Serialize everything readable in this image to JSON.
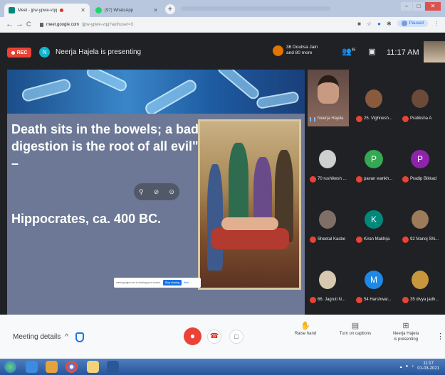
{
  "browser": {
    "tabs": [
      {
        "title": "Meet - jpw-ypwe-vqq",
        "active": true,
        "favicon_color": "#00897b"
      },
      {
        "title": "(97) WhatsApp",
        "active": false,
        "favicon_color": "#25d366"
      }
    ],
    "new_tab_label": "+",
    "window_controls": {
      "minimize": "–",
      "maximize": "□",
      "close": "✕"
    },
    "nav": {
      "back": "←",
      "forward": "→",
      "reload": "C"
    },
    "url_host": "meet.google.com",
    "url_path": "/jpw-ypwe-vqq?authuser=3",
    "profile_status": "Paused"
  },
  "meet_top": {
    "rec_label": "REC",
    "presenter_initial": "N",
    "presenter_text": "Neerja Hajela is presenting",
    "joiners_line1": "36 Doulisa Jain",
    "joiners_line2": "and 80 more",
    "participant_count": "85",
    "time": "11:17 AM"
  },
  "slide": {
    "quote": "Death sits in the bowels; a bad digestion is the root of all evil\" –",
    "author": "Hippocrates, ca. 400 BC.",
    "sharing_text": "meet.google.com is sharing your screen.",
    "stop_sharing": "Stop sharing",
    "hide": "Hide"
  },
  "participants": [
    {
      "name": "Neerja Hajela",
      "speaker": true
    },
    {
      "name": "25. Vighnesh...",
      "photo_color": "#8a5a3c"
    },
    {
      "name": "Pratiksha A",
      "photo_color": "#6b4a3a"
    },
    {
      "name": "70 rushikesh ...",
      "photo_color": "#cfcfcf"
    },
    {
      "name": "pavan wankh...",
      "initial": "P",
      "color": "#34a853"
    },
    {
      "name": "Pradip Bikkad",
      "initial": "P",
      "color": "#8e24aa"
    },
    {
      "name": "Sheetal Kasbe",
      "photo_color": "#7f6f66"
    },
    {
      "name": "Kiran Makhija",
      "initial": "K",
      "color": "#00897b"
    },
    {
      "name": "92 Manoj Shi...",
      "photo_color": "#9c7a5a"
    },
    {
      "name": "66. Jagruti N...",
      "photo_color": "#d8c8b0"
    },
    {
      "name": "54 Harshwar...",
      "initial": "M",
      "color": "#1e88e5"
    },
    {
      "name": "35 divya jadh...",
      "photo_color": "#c8963c"
    }
  ],
  "bottom": {
    "meeting_details": "Meeting details",
    "chevron": "^",
    "raise_hand": "Raise hand",
    "captions": "Turn on captions",
    "presenting_line1": "Neerja Hajela",
    "presenting_line2": "is presenting",
    "more": "⋮"
  },
  "taskbar": {
    "time": "11:17",
    "date": "01-03-2021"
  },
  "colors": {
    "meet_dark": "#202124",
    "rec_red": "#ea4335",
    "accent_blue": "#1a73e8",
    "slide_bg": "#6c7895"
  }
}
